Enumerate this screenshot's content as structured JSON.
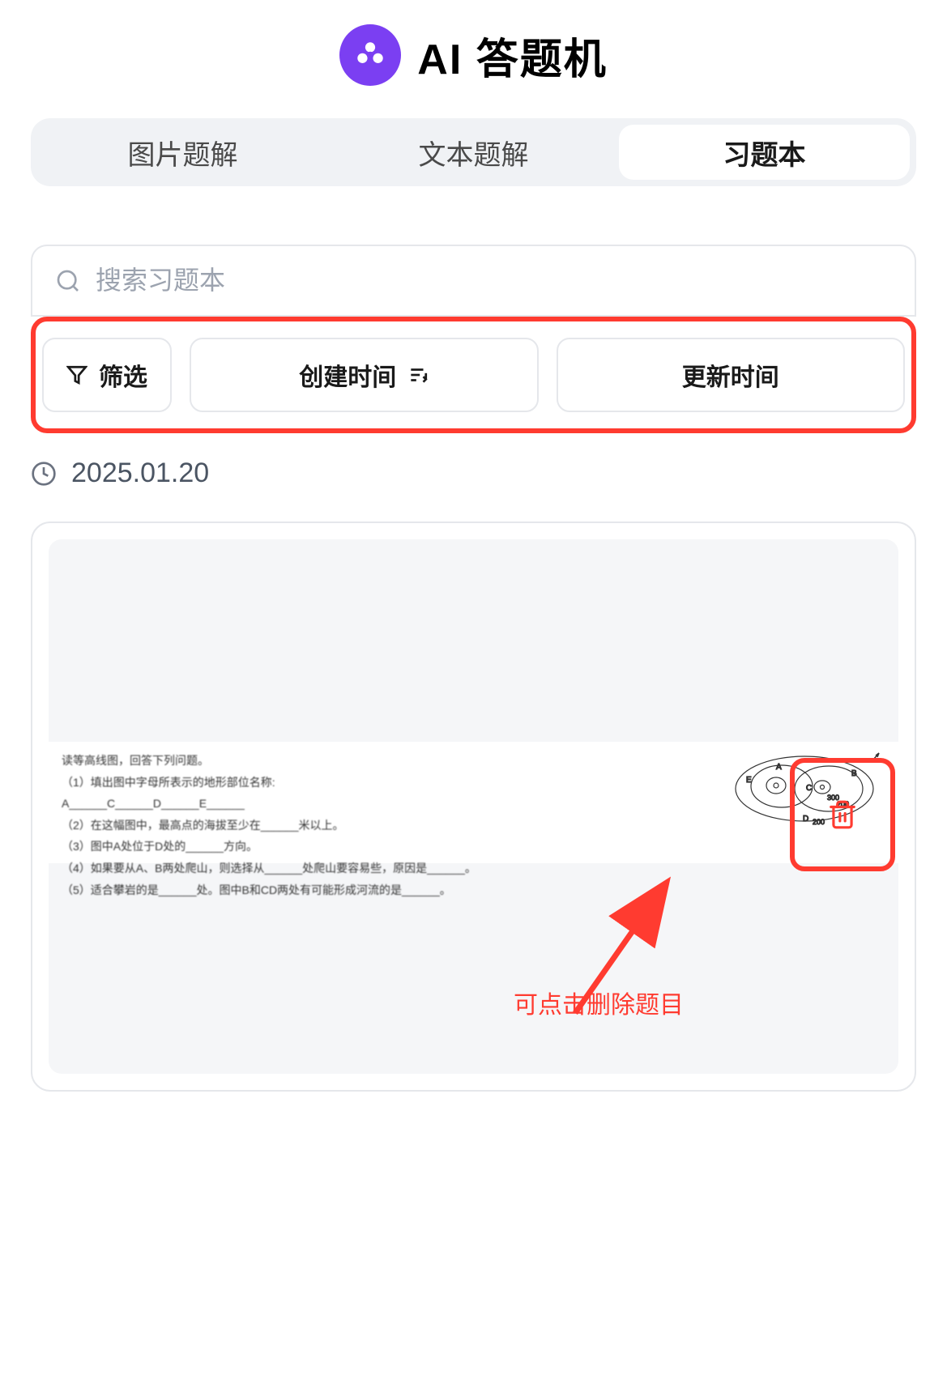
{
  "app": {
    "title": "AI 答题机",
    "logo_color": "#7B3FF2"
  },
  "tabs": [
    {
      "label": "图片题解",
      "active": false
    },
    {
      "label": "文本题解",
      "active": false
    },
    {
      "label": "习题本",
      "active": true
    }
  ],
  "search": {
    "placeholder": "搜索习题本"
  },
  "filters": {
    "filter_label": "筛选",
    "sort_create_label": "创建时间",
    "sort_update_label": "更新时间"
  },
  "date_header": "2025.01.20",
  "question_card": {
    "lines": [
      "读等高线图，回答下列问题。",
      "（1）填出图中字母所表示的地形部位名称:",
      "A______C______D______E______",
      "（2）在这幅图中，最高点的海拔至少在______米以上。",
      "（3）图中A处位于D处的______方向。",
      "（4）如果要从A、B两处爬山，则选择从______处爬山要容易些，原因是______。",
      "（5）适合攀岩的是______处。图中B和CD两处有可能形成河流的是______。"
    ],
    "diagram_labels": [
      "A",
      "B",
      "C",
      "D",
      "E",
      "200",
      "300"
    ]
  },
  "annotations": {
    "delete_hint": "可点击删除题目",
    "highlight_color": "#FF3B30"
  }
}
